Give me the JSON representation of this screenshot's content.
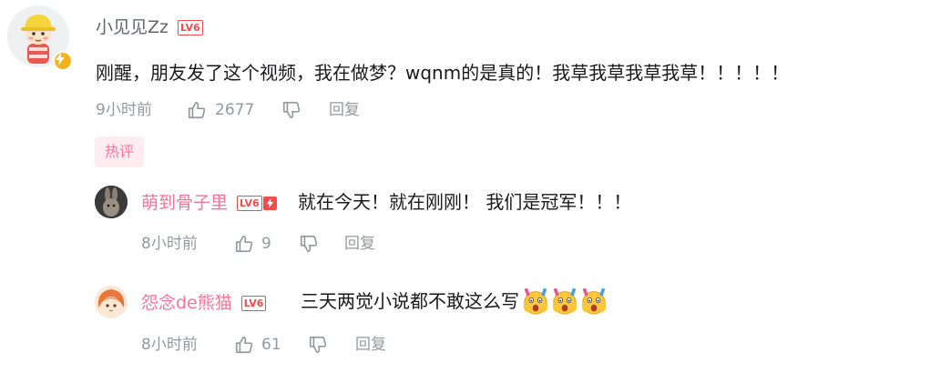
{
  "comment": {
    "username": "小见见Zz",
    "level": "LV6",
    "text": "刚醒，朋友发了这个视频，我在做梦？wqnm的是真的！我草我草我草我草！！！！！",
    "time": "9小时前",
    "likes": "2677",
    "reply_label": "回复",
    "hot_tag": "热评"
  },
  "replies": [
    {
      "username": "萌到骨子里",
      "level": "LV6",
      "text": "就在今天！就在刚刚！ 我们是冠军！！！",
      "time": "8小时前",
      "likes": "9",
      "reply_label": "回复"
    },
    {
      "username": "怨念de熊猫",
      "level": "LV6",
      "text": "三天两觉小说都不敢这么写",
      "time": "8小时前",
      "likes": "61",
      "reply_label": "回复",
      "emoji_count": 3
    }
  ],
  "colors": {
    "username_gray": "#61666d",
    "username_pink": "#fb7299",
    "level_red": "#f04c49",
    "meta_gray": "#9499a0",
    "hot_tag_bg": "#ffecf1"
  }
}
